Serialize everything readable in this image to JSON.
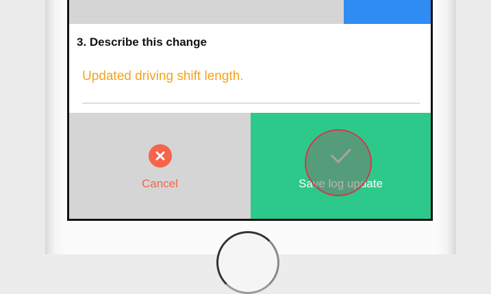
{
  "form": {
    "step_title": "3. Describe this change",
    "answer_value": "Updated driving shift length."
  },
  "actions": {
    "cancel_label": "Cancel",
    "save_label": "Save log update"
  },
  "colors": {
    "accent_orange": "#f5a31a",
    "cancel_red": "#f5644b",
    "save_green": "#2cc98b",
    "top_blue": "#2f8cf2",
    "tap_ring": "#d4354d"
  },
  "icons": {
    "cancel": "close-circle-icon",
    "save": "checkmark-icon"
  }
}
